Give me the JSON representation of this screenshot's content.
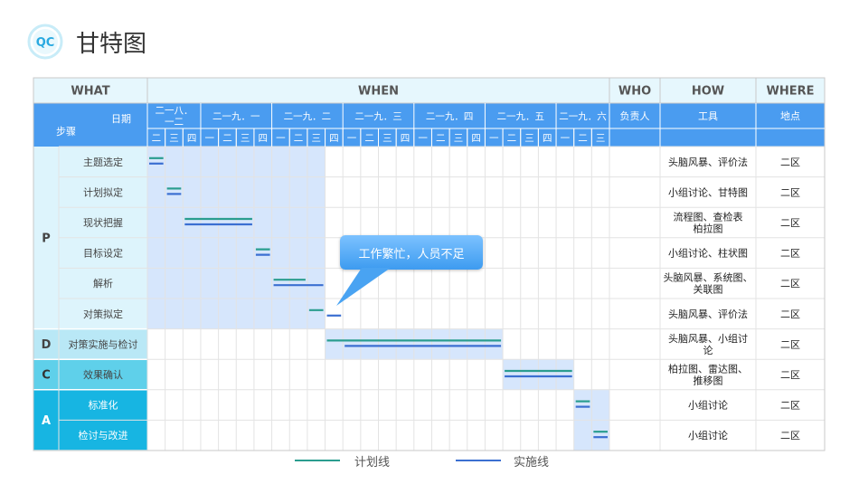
{
  "header": {
    "title": "甘特图",
    "logo_text": "QC"
  },
  "table": {
    "top_headers": [
      "WHAT",
      "WHEN",
      "WHO",
      "HOW",
      "WHERE"
    ],
    "date_label": "日期",
    "step_label": "步骤",
    "months": [
      "二一八．一二",
      "二一九．一",
      "二一九．二",
      "二一九．三",
      "二一九．四",
      "二一九．五",
      "二一九．六"
    ],
    "month_weeks": [
      [
        "二",
        "三",
        "四"
      ],
      [
        "一",
        "二",
        "三",
        "四"
      ],
      [
        "一",
        "二",
        "三",
        "四"
      ],
      [
        "一",
        "二",
        "三",
        "四"
      ],
      [
        "一",
        "二",
        "三",
        "四"
      ],
      [
        "一",
        "二",
        "三",
        "四"
      ],
      [
        "一",
        "二",
        "三"
      ]
    ],
    "col_headers": {
      "who": "负责人",
      "how": "工具",
      "where": "地点"
    },
    "groups": [
      {
        "label": "P",
        "rows": 6,
        "color": "#ddf4fc",
        "text_color": "#444"
      },
      {
        "label": "D",
        "rows": 1,
        "color": "#b9e8f6",
        "text_color": "#444"
      },
      {
        "label": "C",
        "rows": 1,
        "color": "#5fd0ea",
        "text_color": "#333"
      },
      {
        "label": "A",
        "rows": 2,
        "color": "#17b5e2",
        "text_color": "#ffffff"
      }
    ],
    "rows": [
      {
        "step": "主题选定",
        "tool": "头脑风暴、评价法",
        "place": "二区",
        "plan": [
          0,
          1
        ],
        "actual": [
          0,
          1
        ]
      },
      {
        "step": "计划拟定",
        "tool": "小组讨论、甘特图",
        "place": "二区",
        "plan": [
          1,
          2
        ],
        "actual": [
          1,
          2
        ]
      },
      {
        "step": "现状把握",
        "tool": "流程图、查检表\n柏拉图",
        "place": "二区",
        "plan": [
          2,
          6
        ],
        "actual": [
          2,
          6
        ]
      },
      {
        "step": "目标设定",
        "tool": "小组讨论、柱状图",
        "place": "二区",
        "plan": [
          6,
          7
        ],
        "actual": [
          6,
          7
        ]
      },
      {
        "step": "解析",
        "tool": "头脑风暴、系统图、\n关联图",
        "place": "二区",
        "plan": [
          7,
          9
        ],
        "actual": [
          7,
          10
        ]
      },
      {
        "step": "对策拟定",
        "tool": "头脑风暴、评价法",
        "place": "二区",
        "plan": [
          9,
          10
        ],
        "actual": [
          10,
          11
        ]
      },
      {
        "step": "对策实施与检讨",
        "tool": "头脑风暴、小组讨\n论",
        "place": "二区",
        "plan": [
          10,
          20
        ],
        "actual": [
          11,
          20
        ]
      },
      {
        "step": "效果确认",
        "tool": "柏拉图、雷达图、\n推移图",
        "place": "二区",
        "plan": [
          20,
          24
        ],
        "actual": [
          20,
          24
        ]
      },
      {
        "step": "标准化",
        "tool": "小组讨论",
        "place": "二区",
        "plan": [
          24,
          25
        ],
        "actual": [
          24,
          25
        ]
      },
      {
        "step": "检讨与改进",
        "tool": "小组讨论",
        "place": "二区",
        "plan": [
          25,
          26
        ],
        "actual": [
          25,
          26
        ]
      }
    ],
    "shaded_blocks": [
      {
        "col_start": 0,
        "col_end": 10,
        "row_start": 0,
        "row_end": 6
      },
      {
        "col_start": 10,
        "col_end": 20,
        "row_start": 6,
        "row_end": 7
      },
      {
        "col_start": 20,
        "col_end": 24,
        "row_start": 7,
        "row_end": 8
      },
      {
        "col_start": 24,
        "col_end": 26,
        "row_start": 8,
        "row_end": 10
      }
    ]
  },
  "callout": {
    "text": "工作繁忙，人员不足"
  },
  "legend": {
    "plan_label": "计划线",
    "actual_label": "实施线"
  },
  "colors": {
    "header_blue": "#4a9cf0",
    "top_header_bg": "#e6f7fd",
    "shade": "#d6e6fc",
    "grid": "#e3e3e3",
    "plan_line": "#2a9d8f",
    "actual_line": "#3b6fd1",
    "accent": "#2eaee0"
  }
}
